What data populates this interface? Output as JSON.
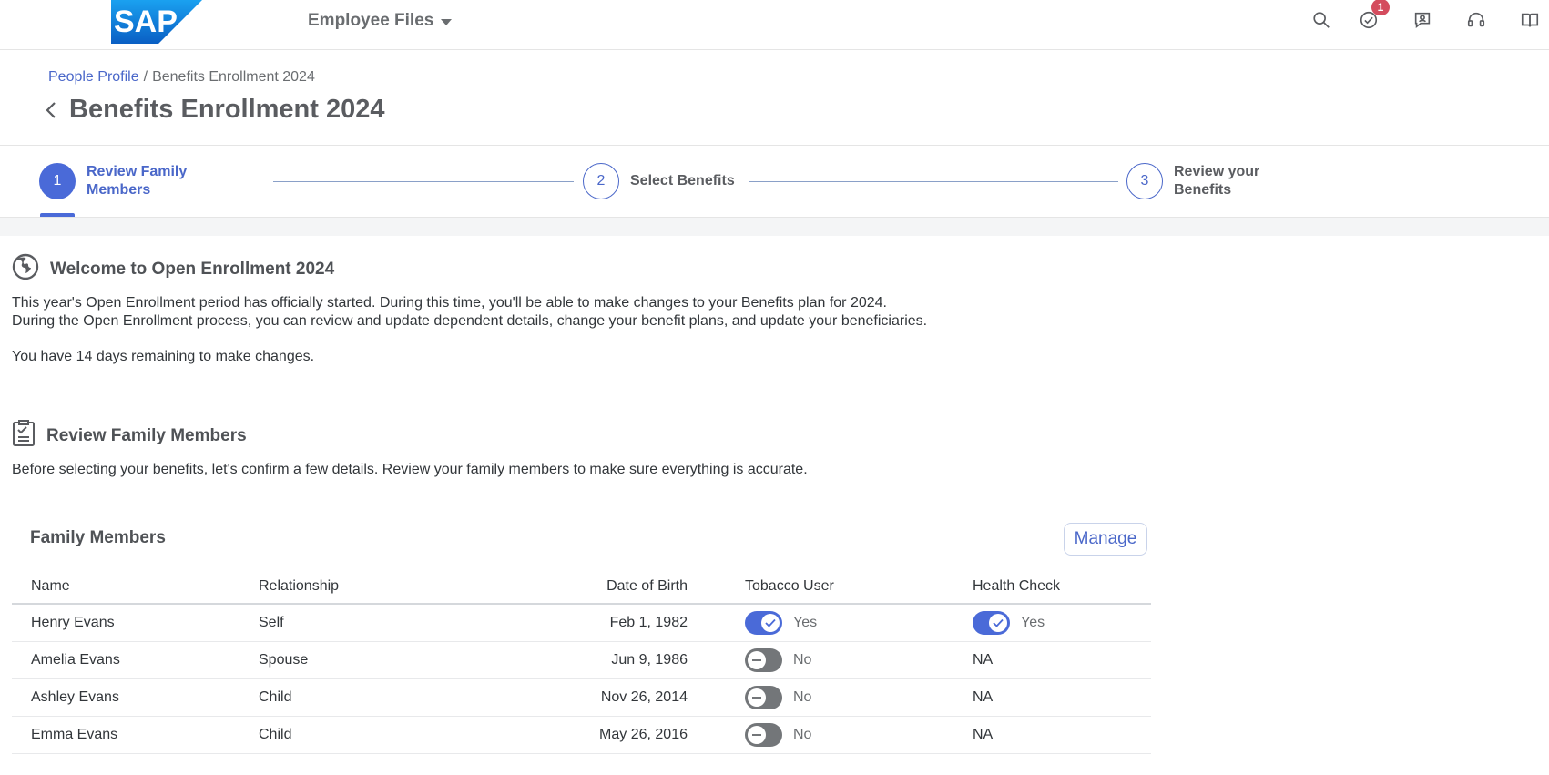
{
  "shell": {
    "logo_text": "SAP",
    "app_title": "Employee Files",
    "notification_count": "1",
    "brand_color": "#0a6ed1",
    "icons": [
      "search-icon",
      "tasks-check-icon",
      "chat-icon",
      "headset-icon",
      "help-book-icon"
    ]
  },
  "breadcrumb": {
    "parent": "People Profile",
    "separator": "/",
    "current": "Benefits Enrollment 2024"
  },
  "page": {
    "title": "Benefits Enrollment 2024"
  },
  "wizard": {
    "steps": [
      {
        "number": "1",
        "label": "Review Family Members",
        "active": true
      },
      {
        "number": "2",
        "label": "Select Benefits",
        "active": false
      },
      {
        "number": "3",
        "label": "Review your Benefits",
        "active": false
      }
    ],
    "accent_color": "#4a6ad8"
  },
  "welcome": {
    "icon": "globe-icon",
    "title": "Welcome to Open Enrollment 2024",
    "line1": "This year's Open Enrollment period has officially started. During this time, you'll be able to make changes to your Benefits plan for 2024.",
    "line2": "During the Open Enrollment process, you can review and update dependent details, change your benefit plans, and update your beneficiaries.",
    "remaining": "You have 14 days remaining to make changes."
  },
  "review": {
    "icon": "checklist-icon",
    "title": "Review Family Members",
    "description": "Before selecting your benefits, let's confirm a few details. Review your family members to make sure everything is accurate."
  },
  "family": {
    "title": "Family Members",
    "manage_label": "Manage",
    "columns": [
      "Name",
      "Relationship",
      "Date of Birth",
      "Tobacco User",
      "Health Check"
    ],
    "rows": [
      {
        "name": "Henry Evans",
        "relationship": "Self",
        "dob": "Feb 1, 1982",
        "tobacco": "Yes",
        "tobacco_on": true,
        "health": "Yes",
        "health_on": true
      },
      {
        "name": "Amelia Evans",
        "relationship": "Spouse",
        "dob": "Jun 9, 1986",
        "tobacco": "No",
        "tobacco_on": false,
        "health": "NA",
        "health_on": null
      },
      {
        "name": "Ashley Evans",
        "relationship": "Child",
        "dob": "Nov 26, 2014",
        "tobacco": "No",
        "tobacco_on": false,
        "health": "NA",
        "health_on": null
      },
      {
        "name": "Emma Evans",
        "relationship": "Child",
        "dob": "May 26, 2016",
        "tobacco": "No",
        "tobacco_on": false,
        "health": "NA",
        "health_on": null
      }
    ]
  }
}
